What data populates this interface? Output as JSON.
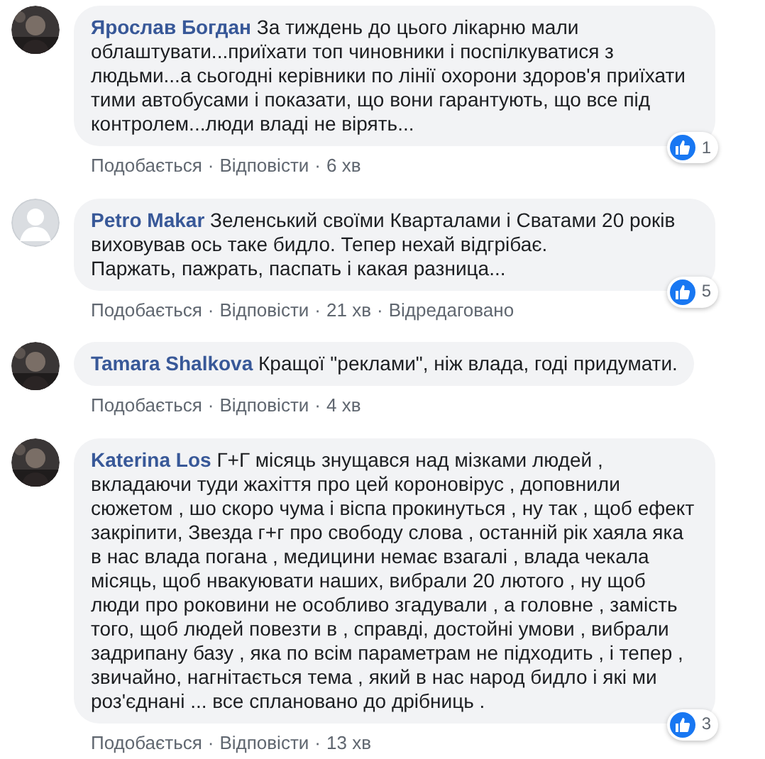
{
  "separator": "·",
  "comments": [
    {
      "author": "Ярослав Богдан",
      "text": "За тиждень до цього лікарню мали облаштувати...приїхати топ чиновники і поспілкуватися з людьми...а сьогодні керівники по лінії охорони здоров'я приїхати тими автобусами і показати, що вони гарантують, що все під контролем...люди владі не вірять...",
      "reactions": "1",
      "actions": [
        "Подобається",
        "Відповісти"
      ],
      "time": "6 хв"
    },
    {
      "author": "Petro Makar",
      "avatar": {
        "kind": "default"
      },
      "text": "Зеленський своїми Кварталами і Сватами 20 років виховував ось таке бидло. Тепер нехай відгрібає.\nПаржать, пажрать, паспать і какая разница...",
      "reactions": "5",
      "actions": [
        "Подобається",
        "Відповісти"
      ],
      "time": "21 хв",
      "edited": "Відредаговано"
    },
    {
      "author": "Tamara Shalkova",
      "text": "Кращої \"реклами\", ніж влада, годі придумати.",
      "actions": [
        "Подобається",
        "Відповісти"
      ],
      "time": "4 хв"
    },
    {
      "author": "Katerina Los",
      "text": "Г+Г місяць знущався над мізками людей , вкладаючи туди жахіття про цей короновірус , доповнили сюжетом , шо скоро чума і віспа прокинуться , ну так , щоб ефект закріпити, Звезда г+г про свободу слова , останній рік хаяла яка в нас влада погана , медицини немає взагалі , влада чекала місяць, щоб нвакуювати наших, вибрали 20 лютого , ну щоб люди про роковини не особливо згадували , а головне , замість того, щоб людей повезти в , справді, достойні умови , вибрали задрипану базу , яка по всім параметрам не підходить , і тепер , звичайно, нагнітається тема , який в нас народ бидло і які ми роз'єднані ... все сплановано до дрібниць .",
      "reactions": "3",
      "actions": [
        "Подобається",
        "Відповісти"
      ],
      "time": "13 хв"
    }
  ]
}
